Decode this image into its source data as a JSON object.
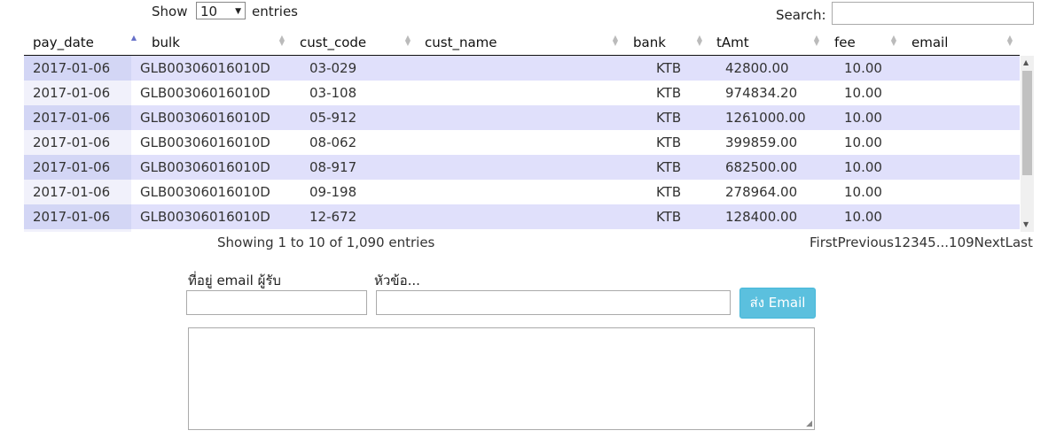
{
  "length_menu": {
    "before": "Show",
    "value": "10",
    "after": "entries"
  },
  "search": {
    "label": "Search:",
    "value": ""
  },
  "columns": [
    "pay_date",
    "bulk",
    "cust_code",
    "cust_name",
    "bank",
    "tAmt",
    "fee",
    "email"
  ],
  "rows": [
    {
      "pay_date": "2017-01-06",
      "bulk": "GLB00306016010D",
      "cust_code": "03-029",
      "cust_name": "",
      "bank": "KTB",
      "tAmt": "42800.00",
      "fee": "10.00",
      "email": ""
    },
    {
      "pay_date": "2017-01-06",
      "bulk": "GLB00306016010D",
      "cust_code": "03-108",
      "cust_name": "",
      "bank": "KTB",
      "tAmt": "974834.20",
      "fee": "10.00",
      "email": ""
    },
    {
      "pay_date": "2017-01-06",
      "bulk": "GLB00306016010D",
      "cust_code": "05-912",
      "cust_name": "",
      "bank": "KTB",
      "tAmt": "1261000.00",
      "fee": "10.00",
      "email": ""
    },
    {
      "pay_date": "2017-01-06",
      "bulk": "GLB00306016010D",
      "cust_code": "08-062",
      "cust_name": "",
      "bank": "KTB",
      "tAmt": "399859.00",
      "fee": "10.00",
      "email": ""
    },
    {
      "pay_date": "2017-01-06",
      "bulk": "GLB00306016010D",
      "cust_code": "08-917",
      "cust_name": "",
      "bank": "KTB",
      "tAmt": "682500.00",
      "fee": "10.00",
      "email": ""
    },
    {
      "pay_date": "2017-01-06",
      "bulk": "GLB00306016010D",
      "cust_code": "09-198",
      "cust_name": "",
      "bank": "KTB",
      "tAmt": "278964.00",
      "fee": "10.00",
      "email": ""
    },
    {
      "pay_date": "2017-01-06",
      "bulk": "GLB00306016010D",
      "cust_code": "12-672",
      "cust_name": "",
      "bank": "KTB",
      "tAmt": "128400.00",
      "fee": "10.00",
      "email": ""
    }
  ],
  "info": "Showing 1 to 10 of 1,090 entries",
  "pager": [
    "First",
    "Previous",
    "1",
    "2",
    "3",
    "4",
    "5",
    "...",
    "109",
    "Next",
    "Last"
  ],
  "form": {
    "email_label": "ที่อยู่ email ผู้รับ",
    "subject_label": "หัวข้อ...",
    "send_label": "ส่ง Email"
  }
}
